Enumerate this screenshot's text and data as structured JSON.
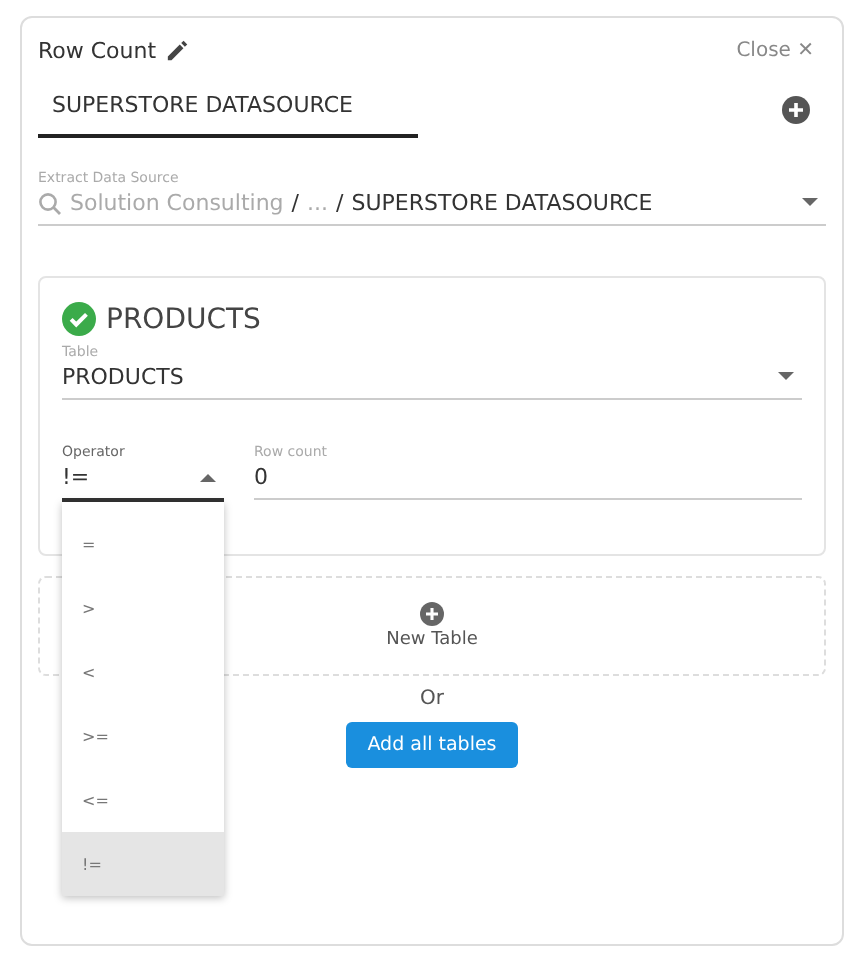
{
  "header": {
    "title": "Row Count",
    "close": "Close ✕"
  },
  "datasource_tab": {
    "value": "SUPERSTORE DATASOURCE"
  },
  "extract_source": {
    "label": "Extract Data Source",
    "path_muted": "Solution Consulting",
    "separator_1": "/",
    "ellipsis": "...",
    "separator_2": "/",
    "current": "SUPERSTORE DATASOURCE"
  },
  "table_card": {
    "title": "PRODUCTS",
    "valid": true,
    "table_label": "Table",
    "table_value": "PRODUCTS",
    "operator_label": "Operator",
    "operator_value": "!=",
    "operator_expanded": true,
    "row_count_label": "Row count",
    "row_count_value": "0"
  },
  "operator_options": [
    {
      "label": "=",
      "selected": false
    },
    {
      "label": ">",
      "selected": false
    },
    {
      "label": "<",
      "selected": false
    },
    {
      "label": ">=",
      "selected": false
    },
    {
      "label": "<=",
      "selected": false
    },
    {
      "label": "!=",
      "selected": true
    }
  ],
  "new_table": {
    "label": "New Table"
  },
  "or_text": "Or",
  "add_all_button": "Add all tables"
}
